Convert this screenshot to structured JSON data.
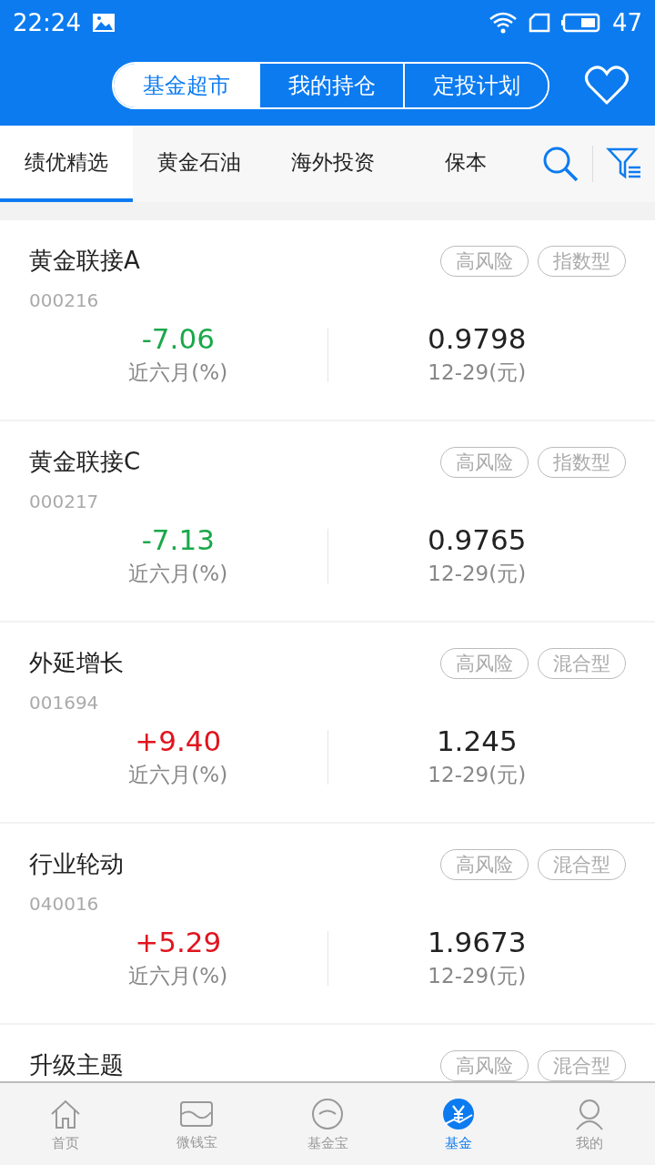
{
  "status_bar": {
    "time": "22:24",
    "battery": "47"
  },
  "header": {
    "segments": [
      {
        "label": "基金超市",
        "selected": true
      },
      {
        "label": "我的持仓",
        "selected": false
      },
      {
        "label": "定投计划",
        "selected": false
      }
    ]
  },
  "category_tabs": [
    {
      "label": "绩优精选",
      "selected": true
    },
    {
      "label": "黄金石油",
      "selected": false
    },
    {
      "label": "海外投资",
      "selected": false
    },
    {
      "label": "保本",
      "selected": false
    }
  ],
  "funds": [
    {
      "name": "黄金联接A",
      "tags": [
        "高风险",
        "指数型"
      ],
      "code": "000216",
      "change": "-7.06",
      "color": "#1aa84a",
      "change_label": "近六月(%)",
      "nav": "0.9798",
      "nav_label": "12-29(元)"
    },
    {
      "name": "黄金联接C",
      "tags": [
        "高风险",
        "指数型"
      ],
      "code": "000217",
      "change": "-7.13",
      "color": "#1aa84a",
      "change_label": "近六月(%)",
      "nav": "0.9765",
      "nav_label": "12-29(元)"
    },
    {
      "name": "外延增长",
      "tags": [
        "高风险",
        "混合型"
      ],
      "code": "001694",
      "change": "+9.40",
      "color": "#e0141e",
      "change_label": "近六月(%)",
      "nav": "1.245",
      "nav_label": "12-29(元)"
    },
    {
      "name": "行业轮动",
      "tags": [
        "高风险",
        "混合型"
      ],
      "code": "040016",
      "change": "+5.29",
      "color": "#e0141e",
      "change_label": "近六月(%)",
      "nav": "1.9673",
      "nav_label": "12-29(元)"
    },
    {
      "name": "升级主题",
      "tags": [
        "高风险",
        "混合型"
      ]
    }
  ],
  "bottom_nav": [
    {
      "label": "首页",
      "kind": "home",
      "selected": false
    },
    {
      "label": "微钱宝",
      "kind": "envelope",
      "selected": false
    },
    {
      "label": "基金宝",
      "kind": "coin",
      "selected": false
    },
    {
      "label": "基金",
      "kind": "yen",
      "selected": true
    },
    {
      "label": "我的",
      "kind": "person",
      "selected": false
    }
  ]
}
